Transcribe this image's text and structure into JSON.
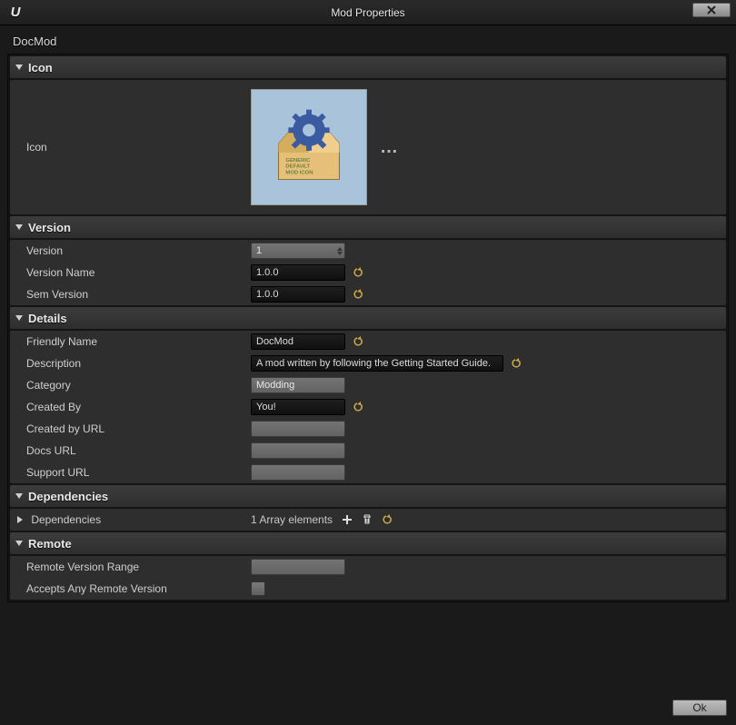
{
  "window": {
    "title": "Mod Properties",
    "mod_name": "DocMod",
    "ok_label": "Ok"
  },
  "sections": {
    "icon": {
      "header": "Icon",
      "row_label": "Icon",
      "image_text_line1": "GENERIC",
      "image_text_line2": "DEFAULT",
      "image_text_line3": "MOD ICON"
    },
    "version": {
      "header": "Version",
      "rows": {
        "version": {
          "label": "Version",
          "value": "1"
        },
        "version_name": {
          "label": "Version Name",
          "value": "1.0.0"
        },
        "sem_version": {
          "label": "Sem Version",
          "value": "1.0.0"
        }
      }
    },
    "details": {
      "header": "Details",
      "rows": {
        "friendly_name": {
          "label": "Friendly Name",
          "value": "DocMod"
        },
        "description": {
          "label": "Description",
          "value": "A mod written by following the Getting Started Guide."
        },
        "category": {
          "label": "Category",
          "value": "Modding"
        },
        "created_by": {
          "label": "Created By",
          "value": "You!"
        },
        "created_by_url": {
          "label": "Created by URL",
          "value": ""
        },
        "docs_url": {
          "label": "Docs URL",
          "value": ""
        },
        "support_url": {
          "label": "Support URL",
          "value": ""
        }
      }
    },
    "dependencies": {
      "header": "Dependencies",
      "row_label": "Dependencies",
      "array_text": "1 Array elements"
    },
    "remote": {
      "header": "Remote",
      "rows": {
        "range": {
          "label": "Remote Version Range",
          "value": ""
        },
        "accepts_any": {
          "label": "Accepts Any Remote Version",
          "checked": false
        }
      }
    }
  }
}
